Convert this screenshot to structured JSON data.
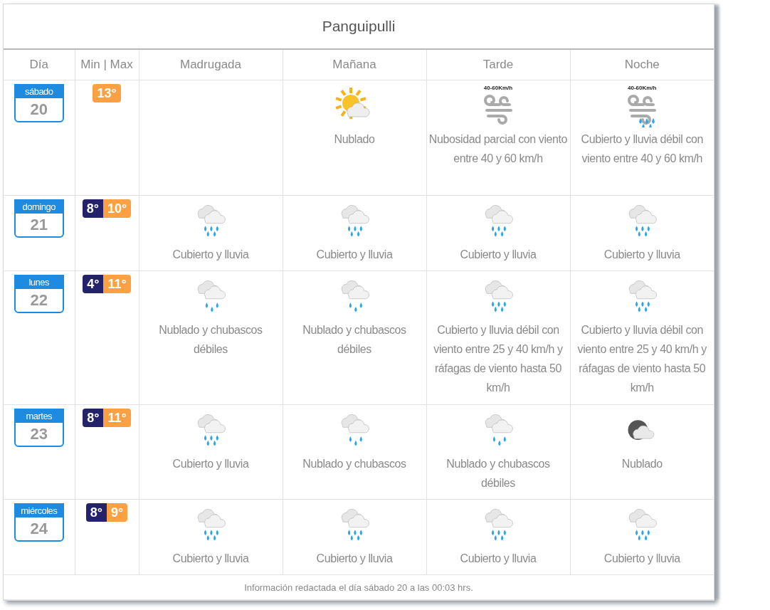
{
  "title": "Panguipulli",
  "columns": [
    "Día",
    "Min | Max",
    "Madrugada",
    "Mañana",
    "Tarde",
    "Noche"
  ],
  "days": [
    {
      "weekday": "sábado",
      "date": "20",
      "max": "13°",
      "periods": [
        {
          "kind": "empty"
        },
        {
          "kind": "sun-cloud",
          "text": "Nublado"
        },
        {
          "kind": "wind",
          "wind_label": "40-60Km/h",
          "text": "Nubosidad parcial con viento entre 40 y 60 km/h"
        },
        {
          "kind": "wind-rain",
          "wind_label": "40-60Km/h",
          "text": "Cubierto y lluvia débil con viento entre 40 y 60 km/h"
        }
      ]
    },
    {
      "weekday": "domingo",
      "date": "21",
      "min": "8°",
      "max": "10°",
      "periods": [
        {
          "kind": "rain",
          "text": "Cubierto y lluvia"
        },
        {
          "kind": "rain",
          "text": "Cubierto y lluvia"
        },
        {
          "kind": "rain",
          "text": "Cubierto y lluvia"
        },
        {
          "kind": "rain",
          "text": "Cubierto y lluvia"
        }
      ]
    },
    {
      "weekday": "lunes",
      "date": "22",
      "min": "4°",
      "max": "11°",
      "periods": [
        {
          "kind": "showers",
          "text": "Nublado y chubascos débiles"
        },
        {
          "kind": "showers",
          "text": "Nublado y chubascos débiles"
        },
        {
          "kind": "rain",
          "text": "Cubierto y lluvia débil con viento entre 25 y 40 km/h y ráfagas de viento hasta 50 km/h"
        },
        {
          "kind": "rain",
          "text": "Cubierto y lluvia débil con viento entre 25 y 40 km/h y ráfagas de viento hasta 50 km/h"
        }
      ]
    },
    {
      "weekday": "martes",
      "date": "23",
      "min": "8°",
      "max": "11°",
      "periods": [
        {
          "kind": "rain",
          "text": "Cubierto y lluvia"
        },
        {
          "kind": "showers",
          "text": "Nublado y chubascos"
        },
        {
          "kind": "showers",
          "text": "Nublado y chubascos débiles"
        },
        {
          "kind": "cloud",
          "text": "Nublado"
        }
      ]
    },
    {
      "weekday": "miércoles",
      "date": "24",
      "min": "8°",
      "max": "9°",
      "periods": [
        {
          "kind": "rain",
          "text": "Cubierto y lluvia"
        },
        {
          "kind": "rain",
          "text": "Cubierto y lluvia"
        },
        {
          "kind": "rain",
          "text": "Cubierto y lluvia"
        },
        {
          "kind": "rain",
          "text": "Cubierto y lluvia"
        }
      ]
    }
  ],
  "footer": "Información redactada el día sábado 20 a las 00:03 hrs."
}
